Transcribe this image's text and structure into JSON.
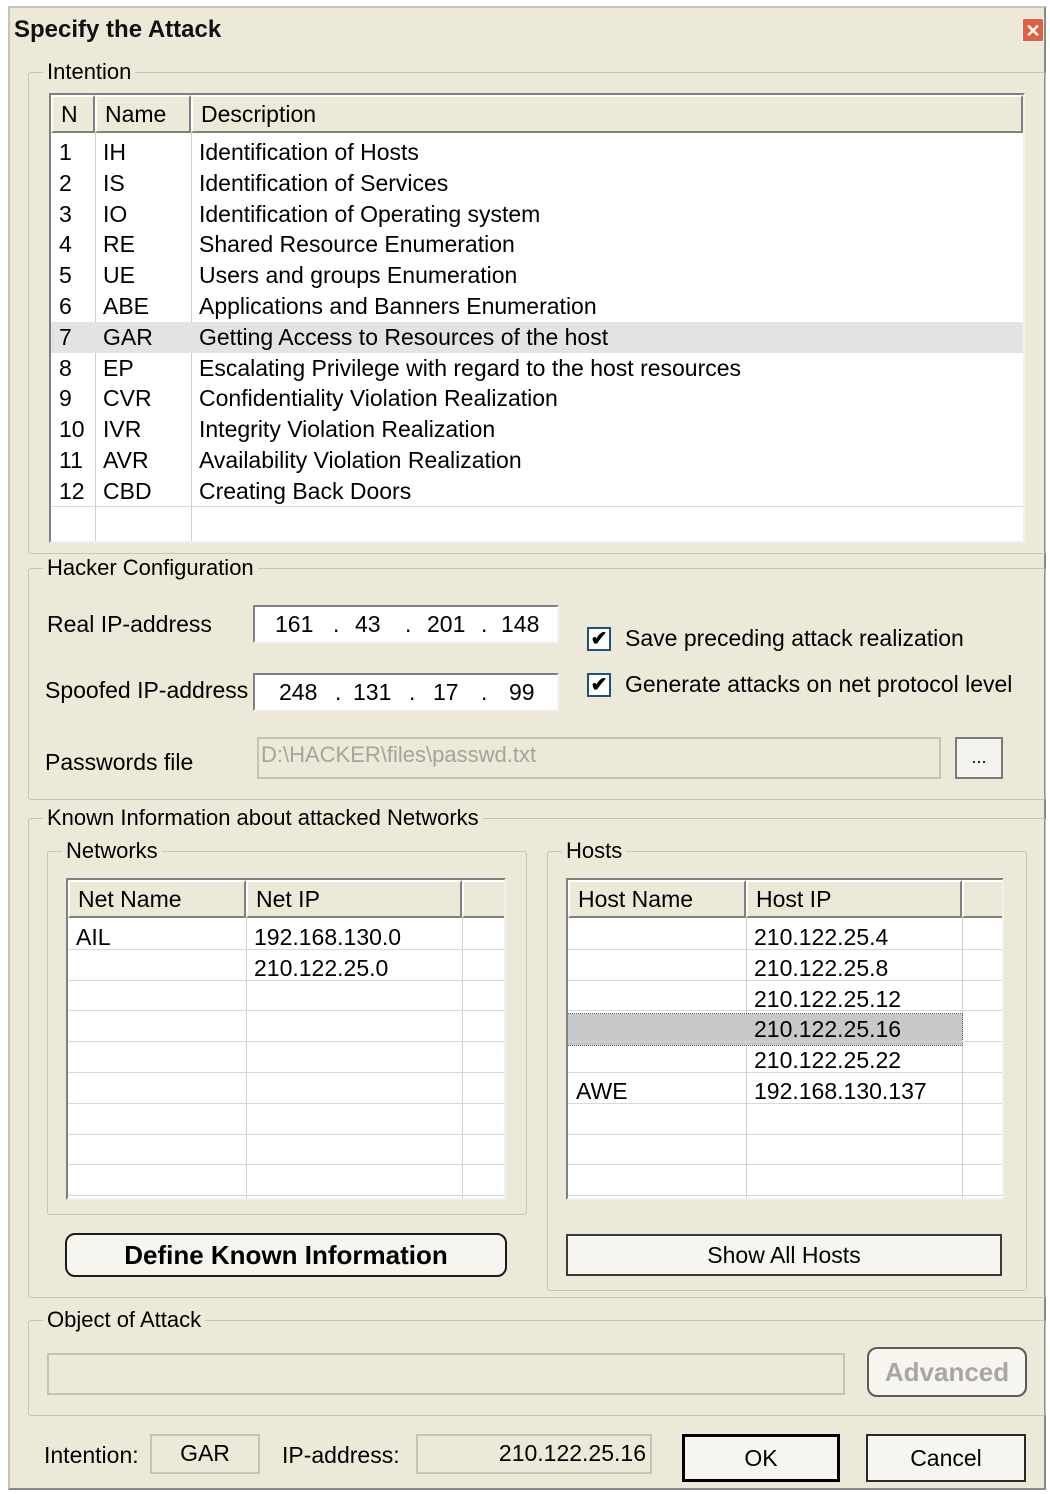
{
  "window": {
    "title": "Specify the Attack",
    "close_glyph": "✕"
  },
  "intention": {
    "group_label": "Intention",
    "columns": [
      "N",
      "Name",
      "Description"
    ],
    "selected_index": 6,
    "rows": [
      {
        "n": "1",
        "name": "IH",
        "desc": "Identification of Hosts"
      },
      {
        "n": "2",
        "name": "IS",
        "desc": "Identification of Services"
      },
      {
        "n": "3",
        "name": "IO",
        "desc": "Identification of Operating system"
      },
      {
        "n": "4",
        "name": "RE",
        "desc": "Shared Resource Enumeration"
      },
      {
        "n": "5",
        "name": "UE",
        "desc": "Users and groups Enumeration"
      },
      {
        "n": "6",
        "name": "ABE",
        "desc": "Applications and Banners Enumeration"
      },
      {
        "n": "7",
        "name": "GAR",
        "desc": "Getting Access to Resources of the host"
      },
      {
        "n": "8",
        "name": "EP",
        "desc": "Escalating Privilege with regard to the host resources"
      },
      {
        "n": "9",
        "name": "CVR",
        "desc": "Confidentiality Violation Realization"
      },
      {
        "n": "10",
        "name": "IVR",
        "desc": "Integrity Violation Realization"
      },
      {
        "n": "11",
        "name": "AVR",
        "desc": "Availability Violation Realization"
      },
      {
        "n": "12",
        "name": "CBD",
        "desc": "Creating Back Doors"
      }
    ]
  },
  "hacker": {
    "group_label": "Hacker Configuration",
    "real_ip_label": "Real IP-address",
    "real_ip": [
      "161",
      "43",
      "201",
      "148"
    ],
    "spoofed_ip_label": "Spoofed IP-address",
    "spoofed_ip": [
      "248",
      "131",
      "17",
      "99"
    ],
    "dot": ".",
    "save_preceding_label": "Save preceding attack realization",
    "save_preceding_checked": true,
    "generate_attacks_label": "Generate attacks on net protocol level",
    "generate_attacks_checked": true,
    "check_glyph": "✔",
    "passwords_label": "Passwords file",
    "passwords_value": "D:\\HACKER\\files\\passwd.txt",
    "browse_label": "..."
  },
  "known": {
    "group_label": "Known Information about attacked Networks",
    "networks": {
      "group_label": "Networks",
      "columns": [
        "Net Name",
        "Net IP"
      ],
      "rows": [
        {
          "name": "AIL",
          "ip": "192.168.130.0"
        },
        {
          "name": "",
          "ip": "210.122.25.0"
        }
      ]
    },
    "hosts": {
      "group_label": "Hosts",
      "columns": [
        "Host Name",
        "Host IP"
      ],
      "selected_index": 3,
      "rows": [
        {
          "name": "",
          "ip": "210.122.25.4"
        },
        {
          "name": "",
          "ip": "210.122.25.8"
        },
        {
          "name": "",
          "ip": "210.122.25.12"
        },
        {
          "name": "",
          "ip": "210.122.25.16"
        },
        {
          "name": "",
          "ip": "210.122.25.22"
        },
        {
          "name": "AWE",
          "ip": "192.168.130.137"
        }
      ]
    },
    "define_button": "Define Known Information",
    "show_all_button": "Show All Hosts"
  },
  "object": {
    "group_label": "Object of Attack",
    "value": "",
    "advanced_button": "Advanced"
  },
  "footer": {
    "intention_label": "Intention:",
    "intention_value": "GAR",
    "ip_label": "IP-address:",
    "ip_value": "210.122.25.16",
    "ok_button": "OK",
    "cancel_button": "Cancel"
  }
}
